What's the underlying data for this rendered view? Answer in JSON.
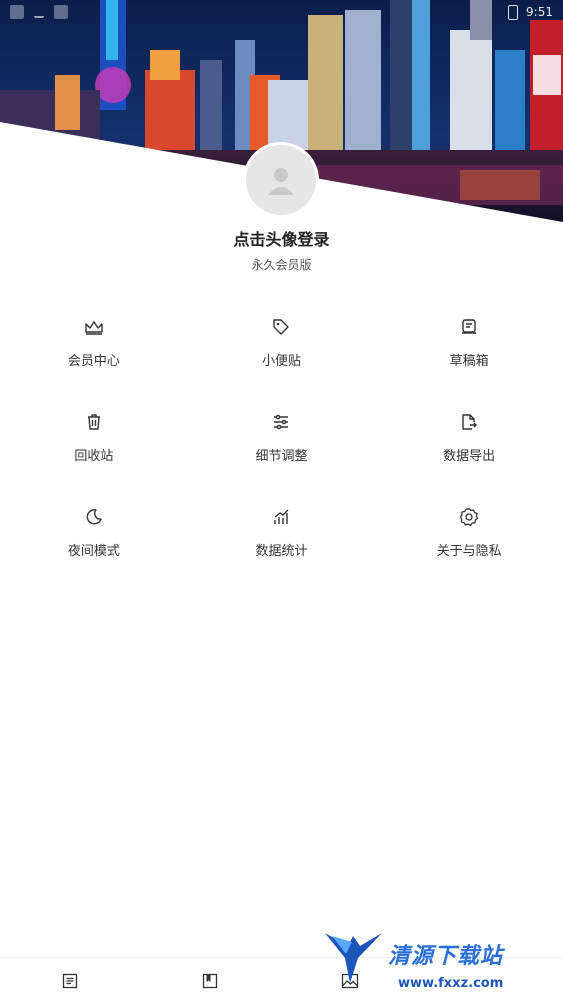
{
  "status_bar": {
    "time": "9:51"
  },
  "profile": {
    "login_prompt": "点击头像登录",
    "membership": "永久会员版",
    "avatar_icon": "user-silhouette-icon"
  },
  "menu": [
    {
      "label": "会员中心",
      "icon": "crown-icon"
    },
    {
      "label": "小便贴",
      "icon": "tag-icon"
    },
    {
      "label": "草稿箱",
      "icon": "draft-box-icon"
    },
    {
      "label": "回收站",
      "icon": "trash-icon"
    },
    {
      "label": "细节调整",
      "icon": "sliders-icon"
    },
    {
      "label": "数据导出",
      "icon": "file-export-icon"
    },
    {
      "label": "夜间模式",
      "icon": "moon-icon"
    },
    {
      "label": "数据统计",
      "icon": "bar-chart-icon"
    },
    {
      "label": "关于与隐私",
      "icon": "gear-icon"
    }
  ],
  "bottom_nav": [
    {
      "icon": "list-icon"
    },
    {
      "icon": "book-icon"
    },
    {
      "icon": "image-icon"
    }
  ],
  "watermark": {
    "text": "清源下载站",
    "url": "www.fxxz.com"
  },
  "colors": {
    "accent": "#2a6fd6",
    "text": "#222222",
    "icon": "#333333"
  }
}
